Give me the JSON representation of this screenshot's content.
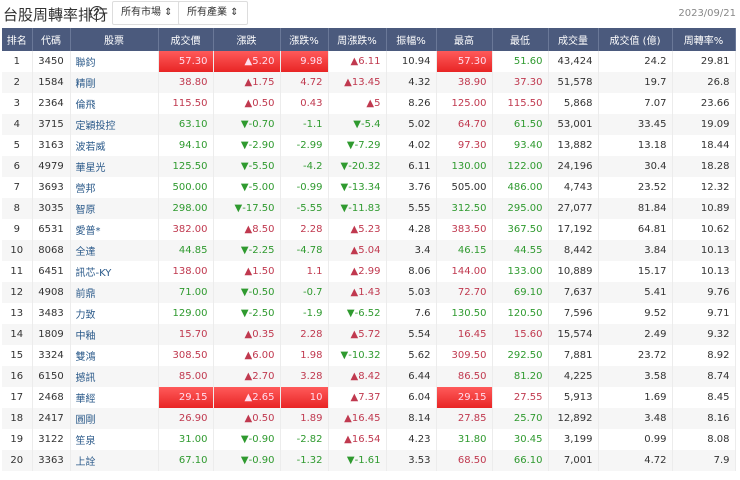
{
  "header": {
    "title": "台股周轉率排行",
    "help_icon": "?",
    "market_select": "所有市場",
    "industry_select": "所有產業",
    "date": "2023/09/21"
  },
  "columns": [
    "排名",
    "代碼",
    "股票",
    "成交價",
    "漲跌",
    "漲跌%",
    "周漲跌%",
    "振幅%",
    "最高",
    "最低",
    "成交量",
    "成交值 (億)",
    "周轉率%"
  ],
  "rows": [
    [
      "1",
      "3450",
      "聯鈞",
      "57.30",
      "5.20",
      "9.98",
      "6.11",
      "10.94",
      "57.30",
      "51.60",
      "43,424",
      "24.2",
      "29.81",
      true
    ],
    [
      "2",
      "1584",
      "精剛",
      "38.80",
      "1.75",
      "4.72",
      "13.45",
      "4.32",
      "38.90",
      "37.30",
      "51,578",
      "19.7",
      "26.8",
      false
    ],
    [
      "3",
      "2364",
      "倫飛",
      "115.50",
      "0.50",
      "0.43",
      "5",
      "8.26",
      "125.00",
      "115.50",
      "5,868",
      "7.07",
      "23.66",
      false
    ],
    [
      "4",
      "3715",
      "定穎投控",
      "63.10",
      "-0.70",
      "-1.1",
      "-5.4",
      "5.02",
      "64.70",
      "61.50",
      "53,001",
      "33.45",
      "19.09",
      false
    ],
    [
      "5",
      "3163",
      "波若威",
      "94.10",
      "-2.90",
      "-2.99",
      "-7.29",
      "4.02",
      "97.30",
      "93.40",
      "13,882",
      "13.18",
      "18.44",
      false
    ],
    [
      "6",
      "4979",
      "華星光",
      "125.50",
      "-5.50",
      "-4.2",
      "-20.32",
      "6.11",
      "130.00",
      "122.00",
      "24,196",
      "30.4",
      "18.28",
      false
    ],
    [
      "7",
      "3693",
      "營邦",
      "500.00",
      "-5.00",
      "-0.99",
      "-13.34",
      "3.76",
      "505.00",
      "486.00",
      "4,743",
      "23.52",
      "12.32",
      false
    ],
    [
      "8",
      "3035",
      "智原",
      "298.00",
      "-17.50",
      "-5.55",
      "-11.83",
      "5.55",
      "312.50",
      "295.00",
      "27,077",
      "81.84",
      "10.89",
      false
    ],
    [
      "9",
      "6531",
      "愛普*",
      "382.00",
      "8.50",
      "2.28",
      "5.23",
      "4.28",
      "383.50",
      "367.50",
      "17,192",
      "64.81",
      "10.62",
      false
    ],
    [
      "10",
      "8068",
      "全達",
      "44.85",
      "-2.25",
      "-4.78",
      "5.04",
      "3.4",
      "46.15",
      "44.55",
      "8,442",
      "3.84",
      "10.13",
      false
    ],
    [
      "11",
      "6451",
      "訊芯-KY",
      "138.00",
      "1.50",
      "1.1",
      "2.99",
      "8.06",
      "144.00",
      "133.00",
      "10,889",
      "15.17",
      "10.13",
      false
    ],
    [
      "12",
      "4908",
      "前鼎",
      "71.00",
      "-0.50",
      "-0.7",
      "1.43",
      "5.03",
      "72.70",
      "69.10",
      "7,637",
      "5.41",
      "9.76",
      false
    ],
    [
      "13",
      "3483",
      "力致",
      "129.00",
      "-2.50",
      "-1.9",
      "-6.52",
      "7.6",
      "130.50",
      "120.50",
      "7,596",
      "9.52",
      "9.71",
      false
    ],
    [
      "14",
      "1809",
      "中釉",
      "15.70",
      "0.35",
      "2.28",
      "5.72",
      "5.54",
      "16.45",
      "15.60",
      "15,574",
      "2.49",
      "9.32",
      false
    ],
    [
      "15",
      "3324",
      "雙鴻",
      "308.50",
      "6.00",
      "1.98",
      "-10.32",
      "5.62",
      "309.50",
      "292.50",
      "7,881",
      "23.72",
      "8.92",
      false
    ],
    [
      "16",
      "6150",
      "撼訊",
      "85.00",
      "2.70",
      "3.28",
      "8.42",
      "6.44",
      "86.50",
      "81.20",
      "4,225",
      "3.58",
      "8.74",
      false
    ],
    [
      "17",
      "2468",
      "華經",
      "29.15",
      "2.65",
      "10",
      "7.37",
      "6.04",
      "29.15",
      "27.55",
      "5,913",
      "1.69",
      "8.45",
      true
    ],
    [
      "18",
      "2417",
      "圓剛",
      "26.90",
      "0.50",
      "1.89",
      "16.45",
      "8.14",
      "27.85",
      "25.70",
      "12,892",
      "3.48",
      "8.16",
      false
    ],
    [
      "19",
      "3122",
      "笙泉",
      "31.00",
      "-0.90",
      "-2.82",
      "16.54",
      "4.23",
      "31.80",
      "30.45",
      "3,199",
      "0.99",
      "8.08",
      false
    ],
    [
      "20",
      "3363",
      "上詮",
      "67.10",
      "-0.90",
      "-1.32",
      "-1.61",
      "3.53",
      "68.50",
      "66.10",
      "7,001",
      "4.72",
      "7.9",
      false
    ]
  ],
  "colors": {
    "up": "#c0394f",
    "down": "#2f9a2f",
    "header": "#4b5a7d",
    "limit_up": "#f03030"
  }
}
